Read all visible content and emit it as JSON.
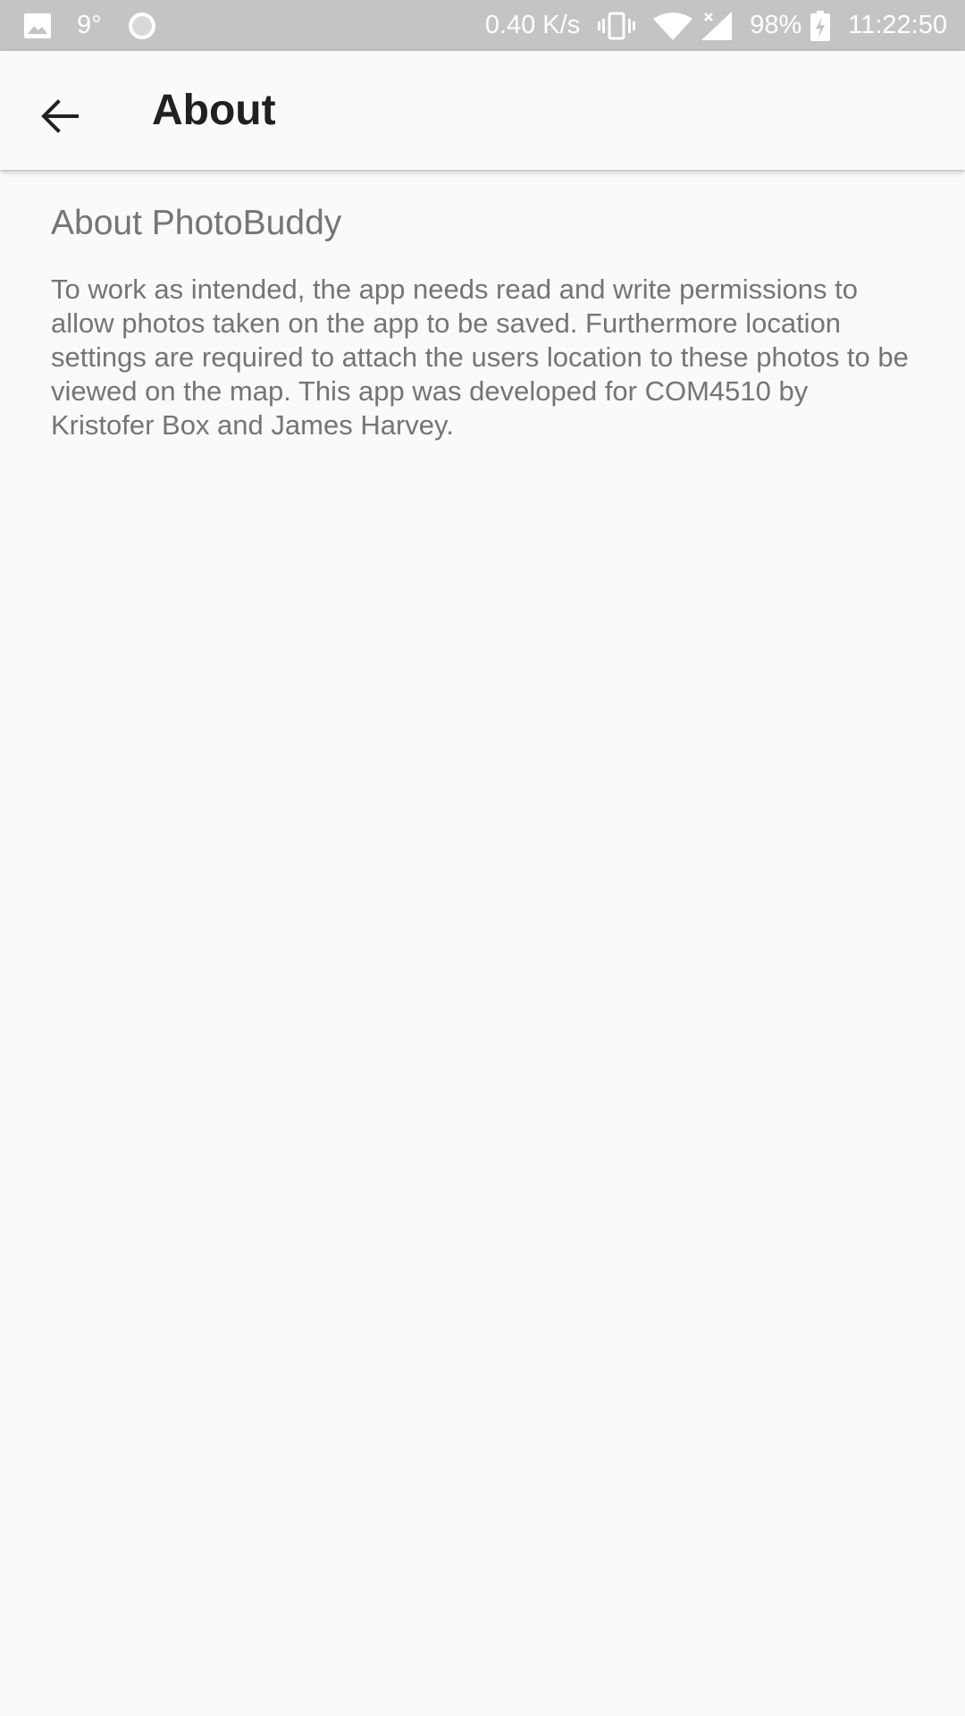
{
  "status_bar": {
    "left_icons": [
      "image-icon",
      "circle-icon"
    ],
    "temperature": "9°",
    "network_speed": "0.40 K/s",
    "right_icons": [
      "vibrate-icon",
      "wifi-icon",
      "signal-icon",
      "battery-charging-icon"
    ],
    "battery": "98%",
    "time": "11:22:50"
  },
  "app_bar": {
    "back_icon": "arrow-left-icon",
    "title": "About"
  },
  "content": {
    "heading": "About PhotoBuddy",
    "body": "To work as intended, the app needs read and write permissions to allow photos taken on the app to be saved. Furthermore location settings are required to attach the users location to these photos to be viewed on the map. This app was developed for COM4510 by Kristofer Box and James Harvey."
  },
  "colors": {
    "status_bar_bg": "#c4c4c4",
    "app_bar_bg": "#fafafa",
    "page_bg": "#fafafa",
    "title_text": "#212121",
    "body_text": "#757575"
  }
}
